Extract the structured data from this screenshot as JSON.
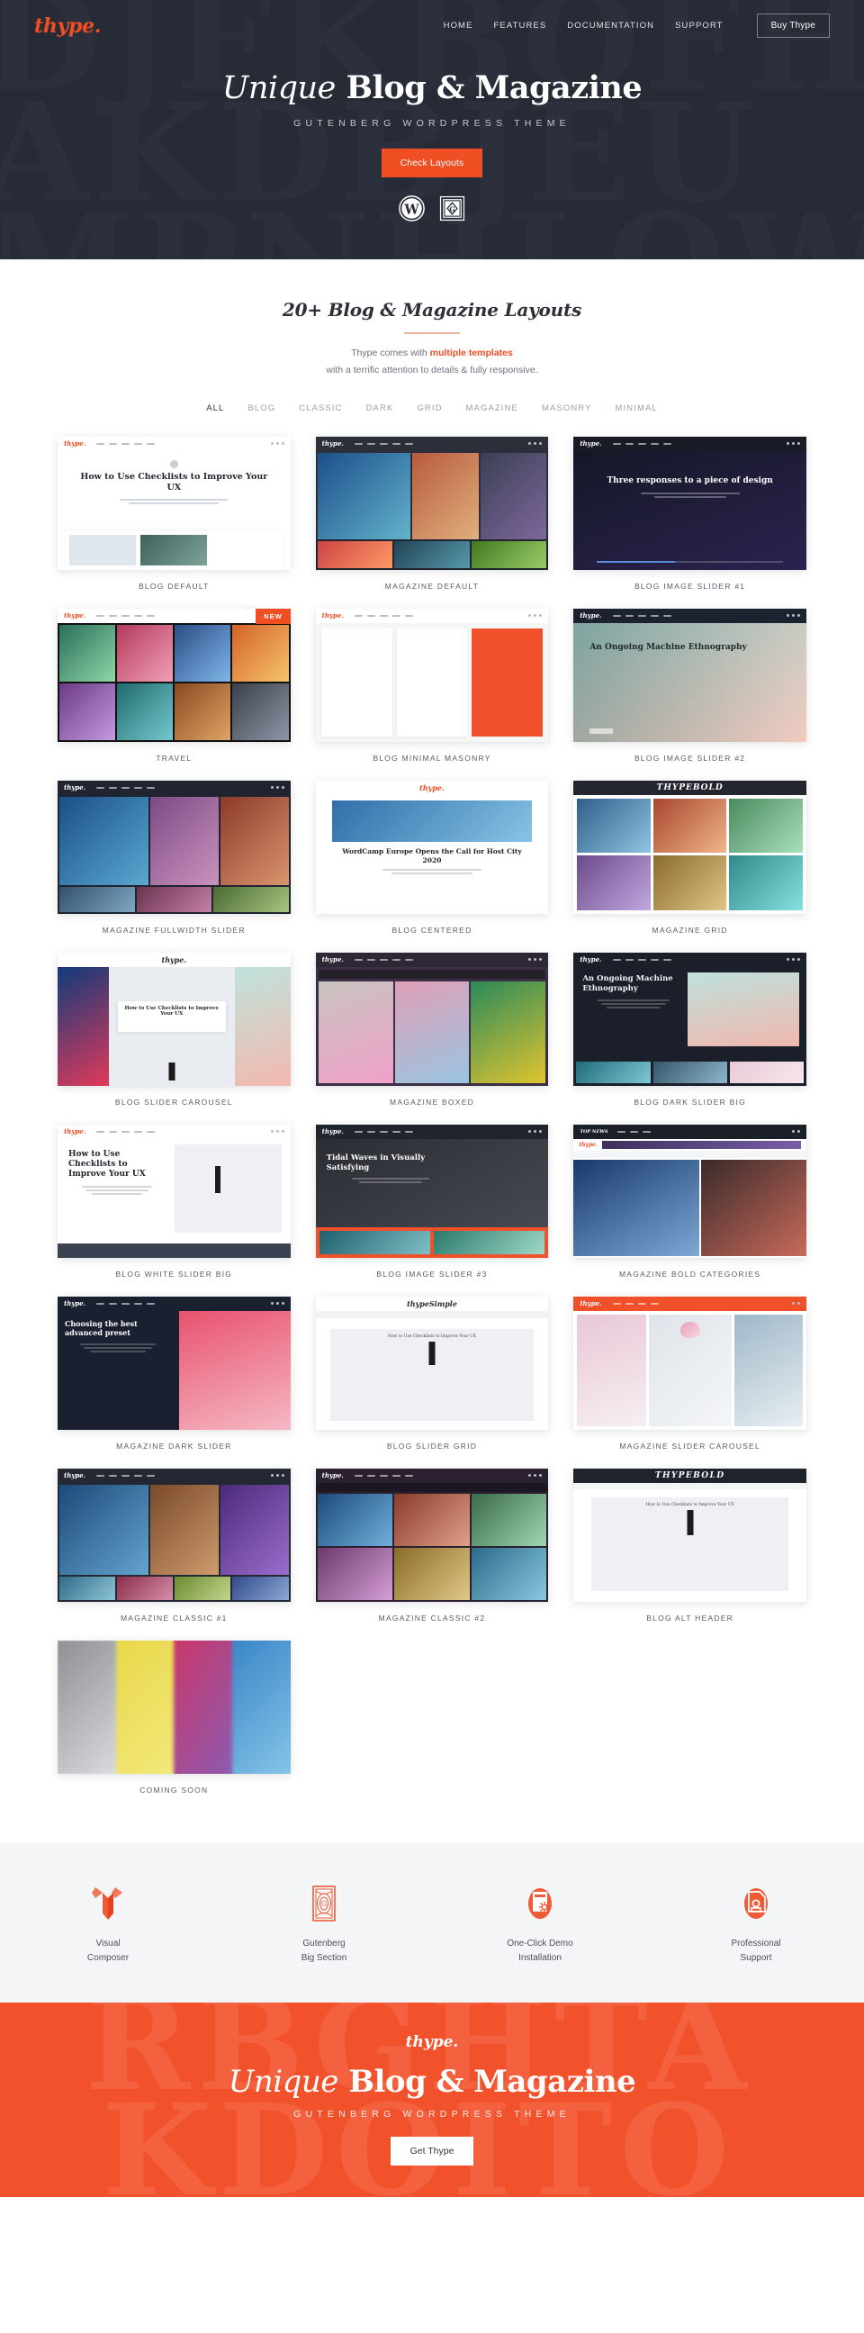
{
  "header": {
    "logo": "thype.",
    "nav": [
      {
        "label": "HOME"
      },
      {
        "label": "FEATURES"
      },
      {
        "label": "DOCUMENTATION"
      },
      {
        "label": "SUPPORT"
      }
    ],
    "buy_button": "Buy Thype"
  },
  "hero": {
    "title_italic": "Unique",
    "title_bold": "Blog & Magazine",
    "subtitle": "GUTENBERG WORDPRESS THEME",
    "cta_button": "Check Layouts",
    "badges": [
      {
        "name": "wordpress-icon",
        "label": "WordPress"
      },
      {
        "name": "gutenberg-icon",
        "label": "Gutenberg"
      }
    ],
    "background_type": "DJFKBOFH\nAKDBJEU\nMPNHLQW"
  },
  "layouts": {
    "title": "20+ Blog & Magazine Layouts",
    "desc_line1_pre": "Thype comes with ",
    "desc_line1_hl": "multiple templates",
    "desc_line2": "with a terrific attention to details & fully responsive.",
    "filters": [
      {
        "label": "ALL",
        "active": true
      },
      {
        "label": "BLOG",
        "active": false
      },
      {
        "label": "CLASSIC",
        "active": false
      },
      {
        "label": "DARK",
        "active": false
      },
      {
        "label": "GRID",
        "active": false
      },
      {
        "label": "MAGAZINE",
        "active": false
      },
      {
        "label": "MASONRY",
        "active": false
      },
      {
        "label": "MINIMAL",
        "active": false
      }
    ],
    "items": [
      {
        "label": "BLOG DEFAULT",
        "style": "blog-default",
        "badge": ""
      },
      {
        "label": "MAGAZINE DEFAULT",
        "style": "magazine-default",
        "badge": ""
      },
      {
        "label": "BLOG IMAGE SLIDER #1",
        "style": "blog-image-slider-1",
        "badge": ""
      },
      {
        "label": "TRAVEL",
        "style": "travel",
        "badge": "NEW"
      },
      {
        "label": "BLOG MINIMAL MASONRY",
        "style": "blog-minimal-masonry",
        "badge": ""
      },
      {
        "label": "BLOG IMAGE SLIDER #2",
        "style": "blog-image-slider-2",
        "badge": ""
      },
      {
        "label": "MAGAZINE FULLWIDTH SLIDER",
        "style": "magazine-fullwidth-slider",
        "badge": ""
      },
      {
        "label": "BLOG CENTERED",
        "style": "blog-centered",
        "badge": ""
      },
      {
        "label": "MAGAZINE GRID",
        "style": "magazine-grid",
        "badge": ""
      },
      {
        "label": "BLOG SLIDER CAROUSEL",
        "style": "blog-slider-carousel",
        "badge": ""
      },
      {
        "label": "MAGAZINE BOXED",
        "style": "magazine-boxed",
        "badge": ""
      },
      {
        "label": "BLOG DARK SLIDER BIG",
        "style": "blog-dark-slider-big",
        "badge": ""
      },
      {
        "label": "BLOG WHITE SLIDER BIG",
        "style": "blog-white-slider-big",
        "badge": ""
      },
      {
        "label": "BLOG IMAGE SLIDER #3",
        "style": "blog-image-slider-3",
        "badge": ""
      },
      {
        "label": "MAGAZINE BOLD CATEGORIES",
        "style": "magazine-bold-categories",
        "badge": ""
      },
      {
        "label": "MAGAZINE DARK SLIDER",
        "style": "magazine-dark-slider",
        "badge": ""
      },
      {
        "label": "BLOG SLIDER GRID",
        "style": "blog-slider-grid",
        "badge": ""
      },
      {
        "label": "MAGAZINE SLIDER CAROUSEL",
        "style": "magazine-slider-carousel",
        "badge": ""
      },
      {
        "label": "MAGAZINE CLASSIC #1",
        "style": "magazine-classic-1",
        "badge": ""
      },
      {
        "label": "MAGAZINE CLASSIC #2",
        "style": "magazine-classic-2",
        "badge": ""
      },
      {
        "label": "BLOG ALT HEADER",
        "style": "blog-alt-header",
        "badge": ""
      },
      {
        "label": "COMING SOON",
        "style": "coming-soon",
        "badge": ""
      }
    ],
    "thumb_text": {
      "checklists": "How to Use Checklists to Improve Your UX",
      "three_responses": "Three responses to a piece of design",
      "ongoing_machine": "An Ongoing Machine Ethnography",
      "tidal_waves": "Tidal Waves in Visually Satisfying",
      "wordcamp": "WordCamp Europe Opens the Call for Host City 2020",
      "thypebold": "THYPEBOLD",
      "thypesimple": "thypeSimple",
      "mini_logo": "thype."
    }
  },
  "features": [
    {
      "label": "Visual\nComposer",
      "icon": "visual-composer-icon"
    },
    {
      "label": "Gutenberg\nBig Section",
      "icon": "gutenberg-icon"
    },
    {
      "label": "One-Click Demo\nInstallation",
      "icon": "one-click-demo-icon"
    },
    {
      "label": "Professional\nSupport",
      "icon": "support-icon"
    }
  ],
  "cta": {
    "logo": "thype.",
    "title_italic": "Unique",
    "title_bold": "Blog & Magazine",
    "subtitle": "GUTENBERG WORDPRESS THEME",
    "button": "Get Thype",
    "background_type": "RBGHTA\nKDOITO\nYEMDJ"
  },
  "colors": {
    "accent": "#f04e23",
    "cta_bg": "#f2522b",
    "hero_bg": "#262b36",
    "features_bg": "#f4f5f6"
  }
}
